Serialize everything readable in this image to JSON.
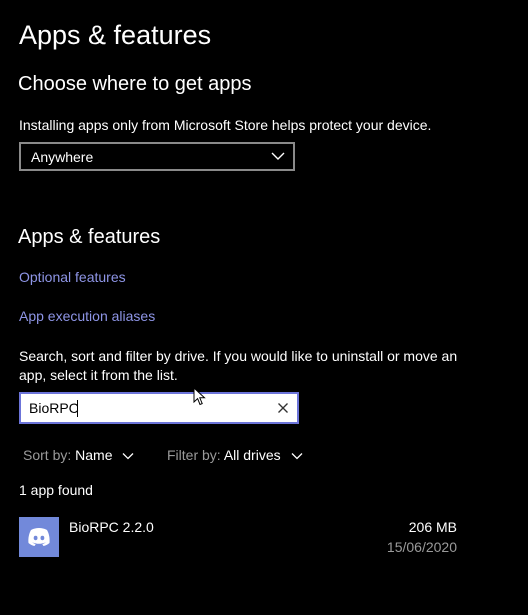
{
  "header": {
    "title": "Apps & features"
  },
  "choose_section": {
    "title": "Choose where to get apps",
    "description": "Installing apps only from Microsoft Store helps protect your device.",
    "dropdown_value": "Anywhere"
  },
  "apps_section": {
    "title": "Apps & features",
    "optional_features_link": "Optional features",
    "aliases_link": "App execution aliases",
    "search_help": "Search, sort and filter by drive. If you would like to uninstall or move an app, select it from the list.",
    "search_value": "BioRPC",
    "sort_label": "Sort by:",
    "sort_value": "Name",
    "filter_label": "Filter by:",
    "filter_value": "All drives",
    "result_count": "1 app found"
  },
  "apps": [
    {
      "name": "BioRPC 2.2.0",
      "size": "206 MB",
      "date": "15/06/2020",
      "icon": "discord-icon"
    }
  ],
  "colors": {
    "background": "#000000",
    "link": "#8e95e6",
    "accent_border": "#6c74d9",
    "secondary_text": "#9a9a9a",
    "app_icon_bg": "#7289da"
  }
}
